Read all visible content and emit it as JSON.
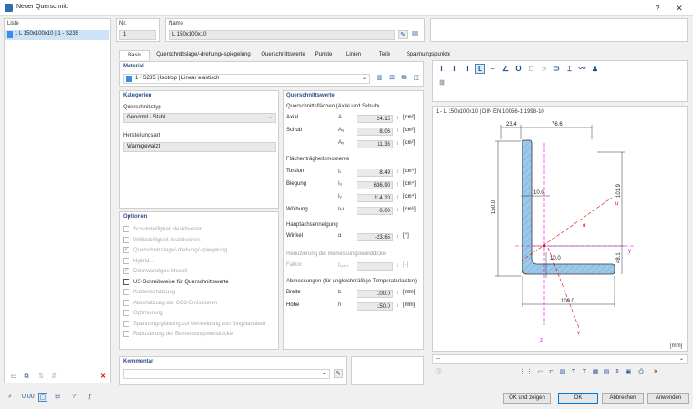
{
  "window": {
    "title": "Neuer Querschnitt"
  },
  "list": {
    "header": "Liste",
    "items": [
      {
        "text": "1  L 150x100x10 | 1 - S235"
      }
    ]
  },
  "nr": {
    "label": "Nr.",
    "value": "1"
  },
  "name": {
    "label": "Name",
    "value": "L 150x100x10"
  },
  "tabs": [
    "Basis",
    "Querschnittslage/-drehung/-spiegelung",
    "Querschnittswerte",
    "Punkte",
    "Linien",
    "Teile",
    "Spannungspunkte"
  ],
  "material": {
    "label": "Material",
    "value": "1 - S235 | Isotrop | Linear elastisch",
    "color": "#3a8ee6"
  },
  "category": {
    "header": "Kategorien",
    "type_label": "Querschnittstyp",
    "type_value": "Genormt - Stahl",
    "manufacture_label": "Herstellungsart",
    "manufacture_value": "Warmgewalzt"
  },
  "options": {
    "header": "Optionen",
    "items": [
      {
        "label": "Schubsteifigkeit deaktivieren",
        "checked": false,
        "active": false
      },
      {
        "label": "Wölbsteifigkeit deaktivieren",
        "checked": false,
        "active": false
      },
      {
        "label": "Querschnittslage/-drehung/-spiegelung",
        "checked": true,
        "active": false
      },
      {
        "label": "Hybrid...",
        "checked": false,
        "active": false
      },
      {
        "label": "Dünnwandiges Modell",
        "checked": true,
        "active": false
      },
      {
        "label": "US-Schreibweise für Querschnittswerte",
        "checked": false,
        "active": true
      },
      {
        "label": "Kostenschätzung",
        "checked": false,
        "active": false
      },
      {
        "label": "Abschätzung der CO2-Emissionen",
        "checked": false,
        "active": false
      },
      {
        "label": "Optimierung",
        "checked": false,
        "active": false
      },
      {
        "label": "Spannungsglättung zur Vermeidung von Singularitäten",
        "checked": false,
        "active": false
      },
      {
        "label": "Reduzierung der Bemessungswanddicke",
        "checked": false,
        "active": false
      }
    ]
  },
  "comment": {
    "label": "Kommentar"
  },
  "props": {
    "header": "Querschnittswerte",
    "areas_header": "Querschnittsflächen (Axial und Schub)",
    "areas": [
      {
        "label": "Axial",
        "sym": "A",
        "value": "24.15",
        "unit": "[cm²]"
      },
      {
        "label": "Schub",
        "sym": "Aᵤ",
        "value": "8.06",
        "unit": "[cm²]"
      },
      {
        "label": "",
        "sym": "Aᵥ",
        "value": "11.36",
        "unit": "[cm²]"
      }
    ],
    "moments_header": "Flächenträgheitsmomente",
    "moments": [
      {
        "label": "Torsion",
        "sym": "Iₜ",
        "value": "8.49",
        "unit": "[cm⁴]"
      },
      {
        "label": "Biegung",
        "sym": "Iᵤ",
        "value": "636.90",
        "unit": "[cm⁴]"
      },
      {
        "label": "",
        "sym": "Iᵥ",
        "value": "114.20",
        "unit": "[cm⁴]"
      },
      {
        "label": "Wölbung",
        "sym": "Iω",
        "value": "0.00",
        "unit": "[cm⁶]"
      }
    ],
    "principal_header": "Hauptachsenneigung",
    "angle": {
      "label": "Winkel",
      "sym": "α",
      "value": "-23.65",
      "unit": "[°]"
    },
    "reduction_header": "Reduzierung der Bemessungswanddicke",
    "factor": {
      "label": "Faktor",
      "sym": "fₜₑₙ,ᵣ",
      "value": "",
      "unit": "[-]"
    },
    "dims_header": "Abmessungen (für ungleichmäßige Temperaturlasten)",
    "dims": [
      {
        "label": "Breite",
        "sym": "b",
        "value": "100.0",
        "unit": "[mm]"
      },
      {
        "label": "Höhe",
        "sym": "h",
        "value": "150.0",
        "unit": "[mm]"
      }
    ]
  },
  "preview": {
    "caption": "1 - L 150x100x10 | DIN EN 10056-1:1998-10",
    "dim_top_left": "23.4",
    "dim_top_right": "76.6",
    "dim_height": "150.0",
    "dim_web": "10.0",
    "dim_flange": "10.0",
    "dim_width": "100.0",
    "dim_right_upper": "101.9",
    "dim_right_lower": "48.1",
    "axis_u": "u",
    "axis_v": "v",
    "axis_y": "y",
    "axis_z": "z",
    "angle_label": "α",
    "unit_label": "[mm]",
    "dropdown_value": "--"
  },
  "buttons": {
    "ok_continue": "OK und zeigen",
    "ok": "OK",
    "cancel": "Abbrechen",
    "apply": "Anwenden"
  }
}
